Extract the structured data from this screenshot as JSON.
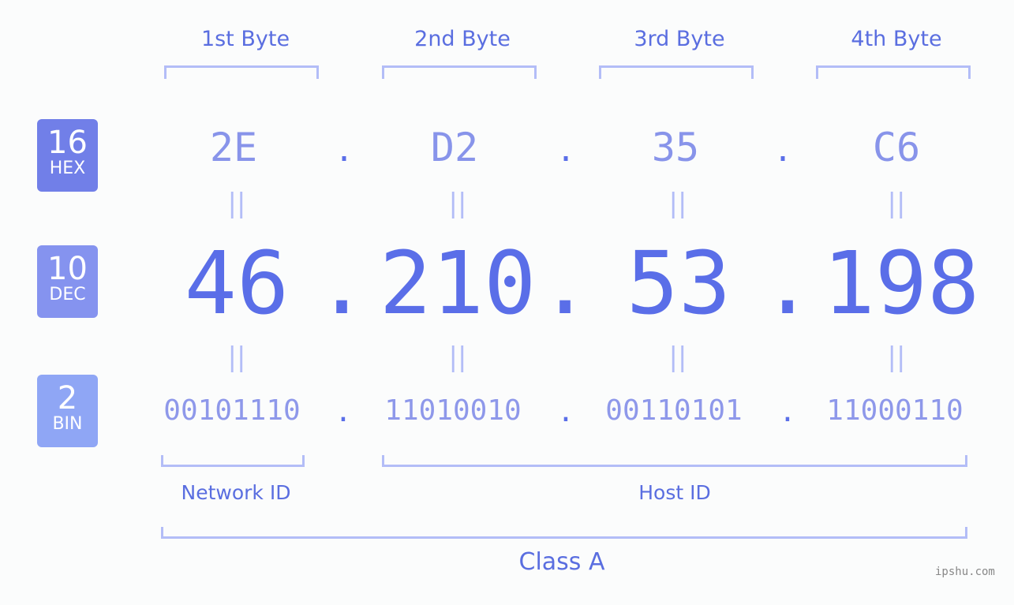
{
  "bytes": {
    "labels": [
      "1st Byte",
      "2nd Byte",
      "3rd Byte",
      "4th Byte"
    ]
  },
  "badges": {
    "hex": {
      "num": "16",
      "label": "HEX",
      "color": "#717fe8"
    },
    "dec": {
      "num": "10",
      "label": "DEC",
      "color": "#8593ef"
    },
    "bin": {
      "num": "2",
      "label": "BIN",
      "color": "#8fa6f5"
    }
  },
  "hex_values": [
    "2E",
    "D2",
    "35",
    "C6"
  ],
  "dec_values": [
    "46",
    "210",
    "53",
    "198"
  ],
  "bin_values": [
    "00101110",
    "11010010",
    "00110101",
    "11000110"
  ],
  "separator": ".",
  "equals": "||",
  "network_id_label": "Network ID",
  "host_id_label": "Host ID",
  "class_label": "Class A",
  "watermark": "ipshu.com"
}
